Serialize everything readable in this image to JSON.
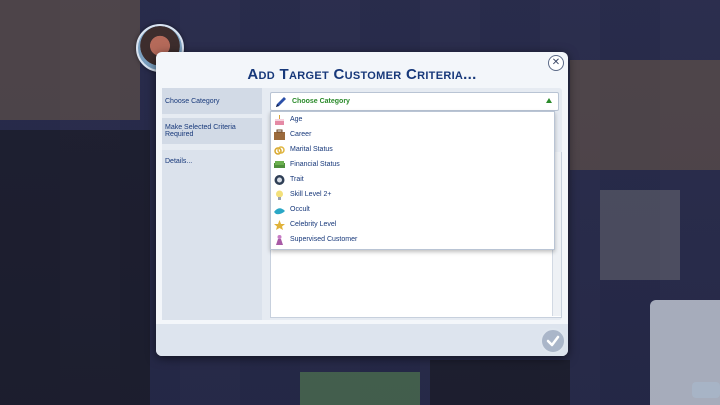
{
  "dialog": {
    "title": "Add Target Customer Criteria...",
    "close_icon": "close-icon",
    "confirm_icon": "checkmark-icon"
  },
  "rows": {
    "choose_category_label": "Choose Category",
    "criteria_required_label": "Make Selected Criteria Required",
    "details_label": "Details..."
  },
  "select": {
    "selected": "Choose Category",
    "icon": "pencil-icon"
  },
  "dropdown": {
    "items": [
      {
        "label": "Age",
        "icon": "cake-icon"
      },
      {
        "label": "Career",
        "icon": "briefcase-icon"
      },
      {
        "label": "Marital Status",
        "icon": "rings-icon"
      },
      {
        "label": "Financial Status",
        "icon": "money-icon"
      },
      {
        "label": "Trait",
        "icon": "trait-icon"
      },
      {
        "label": "Skill Level 2+",
        "icon": "lightbulb-icon"
      },
      {
        "label": "Occult",
        "icon": "occult-icon"
      },
      {
        "label": "Celebrity Level",
        "icon": "star-icon"
      },
      {
        "label": "Supervised Customer",
        "icon": "child-icon"
      }
    ]
  },
  "colors": {
    "title": "#17387a",
    "accent_green": "#2a8a2a",
    "panel": "#f3f6fa"
  }
}
